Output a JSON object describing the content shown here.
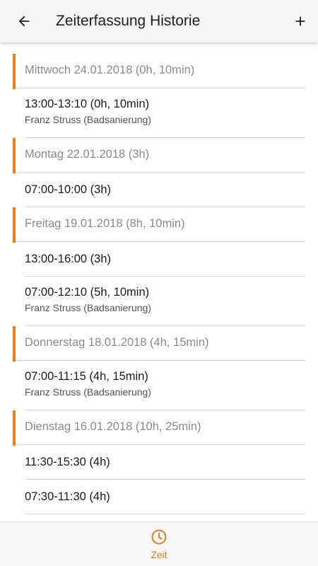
{
  "header": {
    "title": "Zeiterfassung Historie",
    "back_icon": "arrow-left-icon",
    "add_icon": "plus-icon"
  },
  "colors": {
    "accent": "#e67e22",
    "header_text": "#8a8a8a",
    "primary_text": "#1a1a1a"
  },
  "history": {
    "groups": [
      {
        "label": "Mittwoch 24.01.2018 (0h, 10min)",
        "entries": [
          {
            "time": "13:00-13:10 (0h, 10min)",
            "detail": "Franz Struss (Badsanierung)"
          }
        ]
      },
      {
        "label": "Montag 22.01.2018 (3h)",
        "entries": [
          {
            "time": "07:00-10:00 (3h)"
          }
        ]
      },
      {
        "label": "Freitag 19.01.2018 (8h, 10min)",
        "entries": [
          {
            "time": "13:00-16:00 (3h)"
          },
          {
            "time": "07:00-12:10 (5h, 10min)",
            "detail": "Franz Struss (Badsanierung)"
          }
        ]
      },
      {
        "label": "Donnerstag 18.01.2018 (4h, 15min)",
        "entries": [
          {
            "time": "07:00-11:15 (4h, 15min)",
            "detail": "Franz Struss (Badsanierung)"
          }
        ]
      },
      {
        "label": "Dienstag 16.01.2018 (10h, 25min)",
        "entries": [
          {
            "time": "11:30-15:30 (4h)"
          },
          {
            "time": "07:30-11:30 (4h)"
          }
        ]
      }
    ]
  },
  "bottom_nav": {
    "items": [
      {
        "label": "Zeit",
        "icon": "clock-icon",
        "active": true
      }
    ]
  }
}
